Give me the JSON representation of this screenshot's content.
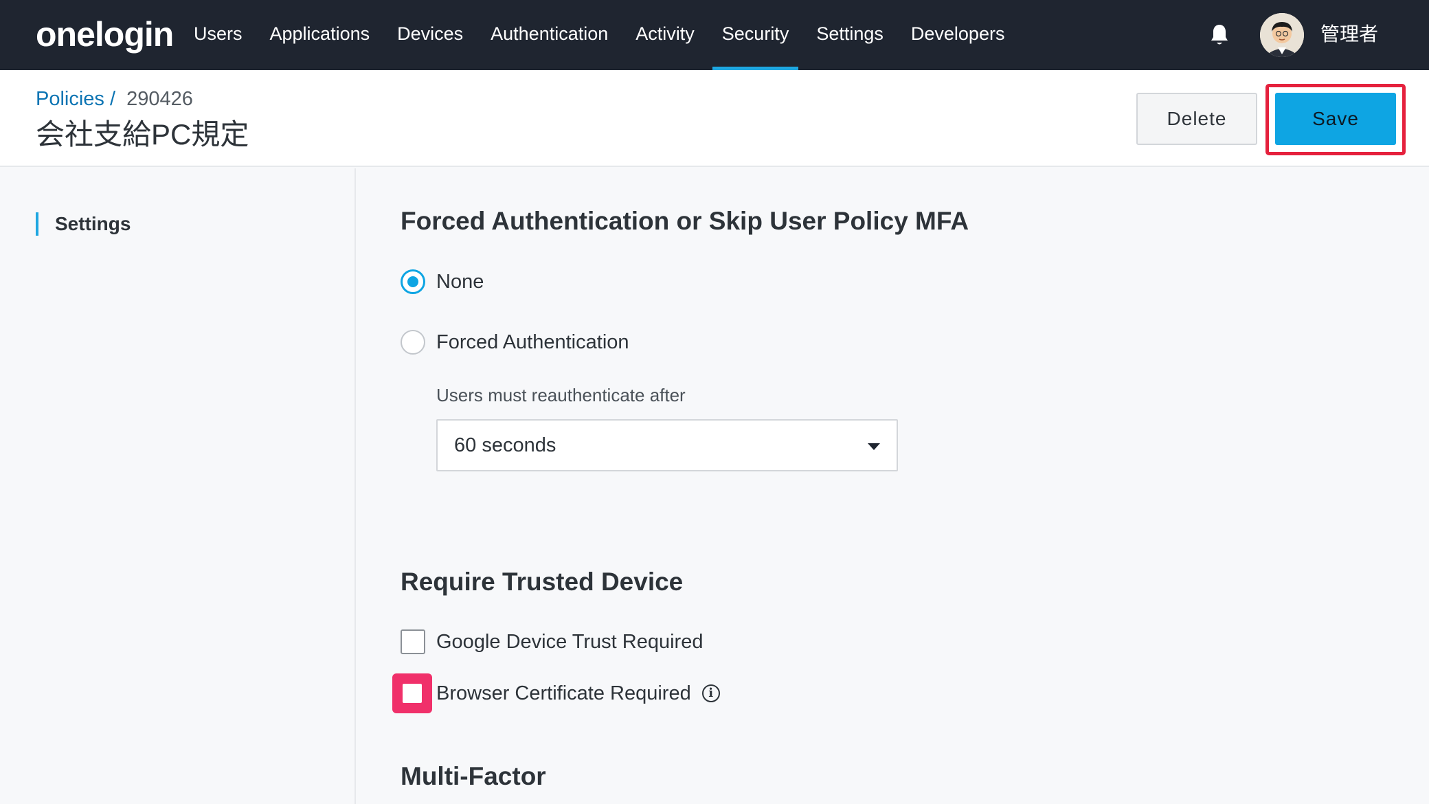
{
  "nav": {
    "logo": "onelogin",
    "items": [
      {
        "label": "Users"
      },
      {
        "label": "Applications"
      },
      {
        "label": "Devices"
      },
      {
        "label": "Authentication"
      },
      {
        "label": "Activity"
      },
      {
        "label": "Security",
        "active": true
      },
      {
        "label": "Settings"
      },
      {
        "label": "Developers"
      }
    ],
    "user_name": "管理者",
    "icons": [
      "bell-icon",
      "avatar"
    ]
  },
  "header": {
    "breadcrumb": {
      "parent": "Policies",
      "separator": "/",
      "current": "290426"
    },
    "title": "会社支給PC規定",
    "delete_label": "Delete",
    "save_label": "Save"
  },
  "sidebar": {
    "items": [
      {
        "label": "Settings",
        "active": true
      }
    ]
  },
  "main": {
    "forced_auth": {
      "title": "Forced Authentication or Skip User Policy MFA",
      "options": [
        {
          "label": "None",
          "selected": true
        },
        {
          "label": "Forced Authentication",
          "selected": false
        }
      ],
      "reauth_label": "Users must reauthenticate after",
      "reauth_value": "60 seconds"
    },
    "trusted_device": {
      "title": "Require Trusted Device",
      "options": [
        {
          "label": "Google Device Trust Required",
          "checked": false
        },
        {
          "label": "Browser Certificate Required",
          "checked": false,
          "info_icon": "info-icon"
        }
      ]
    },
    "mfa": {
      "title": "Multi-Factor"
    }
  },
  "colors": {
    "nav_bg": "#1f2530",
    "accent": "#0ea5e3",
    "highlight_red": "#e5213d",
    "highlight_pink": "#f0306a",
    "link": "#0b74b3"
  }
}
